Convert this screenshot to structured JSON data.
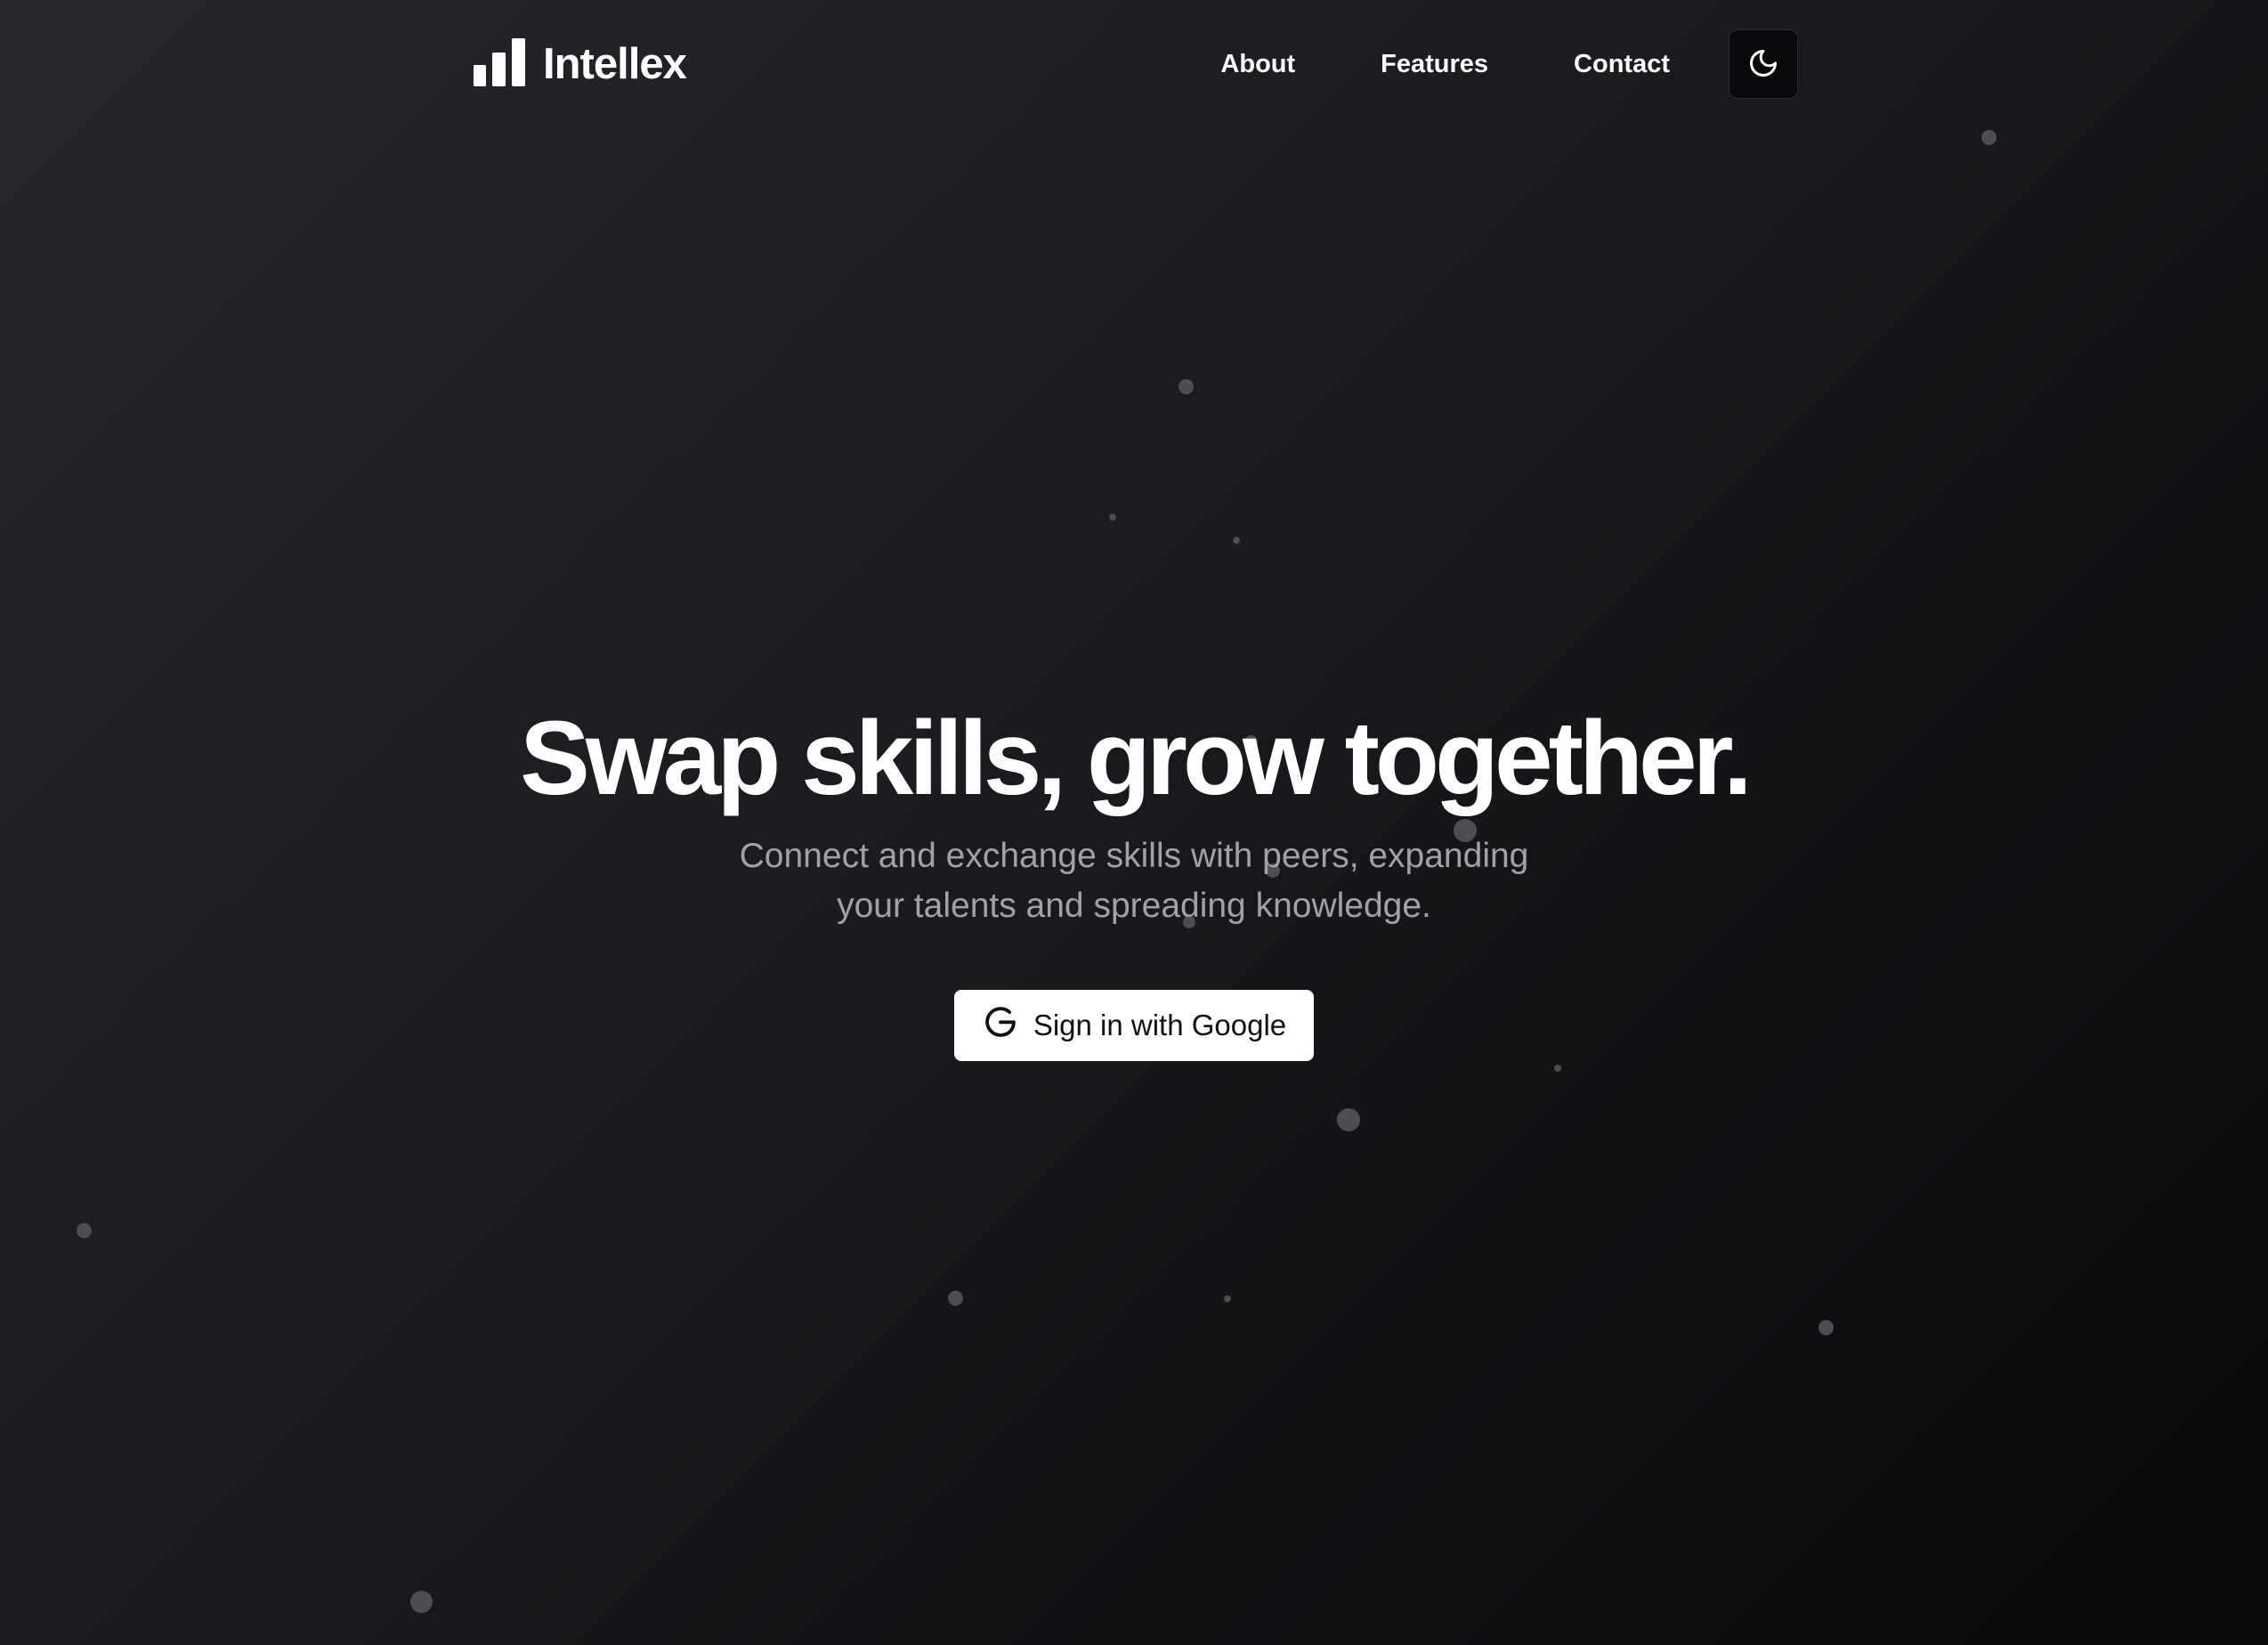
{
  "brand": {
    "name": "Intellex",
    "icon": "bar-chart-icon"
  },
  "nav": {
    "links": [
      {
        "label": "About"
      },
      {
        "label": "Features"
      },
      {
        "label": "Contact"
      }
    ],
    "theme_toggle_icon": "moon-icon"
  },
  "hero": {
    "title": "Swap skills, grow together.",
    "subtitle": "Connect and exchange skills with peers, expanding your talents and spreading knowledge.",
    "cta": {
      "label": "Sign in with Google",
      "icon": "google-icon"
    }
  },
  "colors": {
    "background_dark": "#1c1c20",
    "text_primary": "#ffffff",
    "text_muted": "#a1a1aa",
    "button_bg": "#ffffff",
    "particle": "#4d4d52"
  }
}
